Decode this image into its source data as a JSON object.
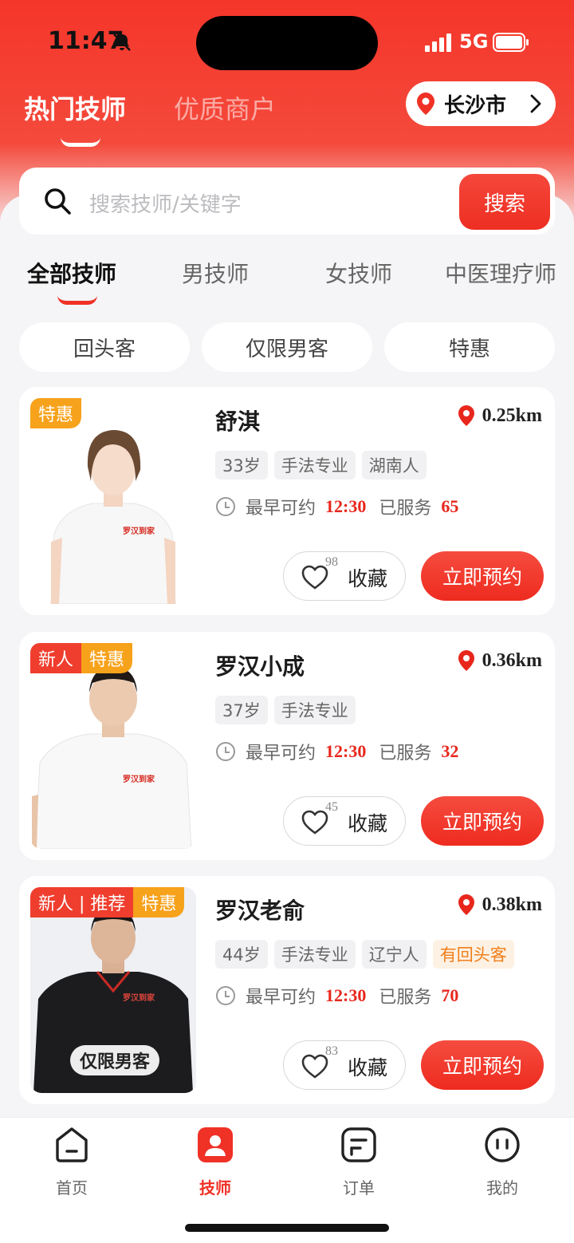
{
  "status": {
    "time": "11:47",
    "network": "5G"
  },
  "top_tabs": [
    {
      "label": "热门技师",
      "active": true
    },
    {
      "label": "优质商户",
      "active": false
    }
  ],
  "city": {
    "label": "长沙市"
  },
  "search": {
    "placeholder": "搜索技师/关键字",
    "button": "搜索"
  },
  "categories": [
    "全部技师",
    "男技师",
    "女技师",
    "中医理疗师"
  ],
  "filters": [
    "回头客",
    "仅限男客",
    "特惠"
  ],
  "cards": [
    {
      "name": "舒淇",
      "distance": "0.25km",
      "tags": [
        "特惠"
      ],
      "chips": [
        "33岁",
        "手法专业",
        "湖南人"
      ],
      "earliest_label": "最早可约",
      "earliest_time": "12:30",
      "served_label": "已服务",
      "served": "65",
      "fav_count": "98",
      "fav_label": "收藏",
      "book_label": "立即预约",
      "shirt_text": "罗汉到家"
    },
    {
      "name": "罗汉小成",
      "distance": "0.36km",
      "tags": [
        "新人",
        "特惠"
      ],
      "chips": [
        "37岁",
        "手法专业"
      ],
      "earliest_label": "最早可约",
      "earliest_time": "12:30",
      "served_label": "已服务",
      "served": "32",
      "fav_count": "45",
      "fav_label": "收藏",
      "book_label": "立即预约",
      "shirt_text": "罗汉到家"
    },
    {
      "name": "罗汉老俞",
      "distance": "0.38km",
      "tags": [
        "新人 | 推荐",
        "特惠"
      ],
      "chips": [
        "44岁",
        "手法专业",
        "辽宁人",
        "有回头客"
      ],
      "earliest_label": "最早可约",
      "earliest_time": "12:30",
      "served_label": "已服务",
      "served": "70",
      "fav_count": "83",
      "fav_label": "收藏",
      "book_label": "立即预约",
      "only_men": "仅限男客",
      "shirt_text": "罗汉到家"
    }
  ],
  "nav": [
    {
      "label": "首页",
      "icon": "home-icon"
    },
    {
      "label": "技师",
      "icon": "technician-icon",
      "active": true
    },
    {
      "label": "订单",
      "icon": "order-icon"
    },
    {
      "label": "我的",
      "icon": "profile-icon"
    }
  ],
  "colors": {
    "accent": "#ef3126",
    "tag_orange": "#f7a21b",
    "highlight": "#f07f1b"
  }
}
